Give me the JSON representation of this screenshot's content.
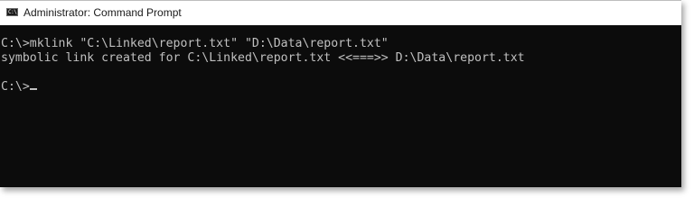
{
  "window": {
    "title": "Administrator: Command Prompt",
    "icon": "cmd-icon",
    "icon_glyph": "C:\\"
  },
  "console": {
    "lines": [
      "C:\\>mklink \"C:\\Linked\\report.txt\" \"D:\\Data\\report.txt\"",
      "symbolic link created for C:\\Linked\\report.txt <<===>> D:\\Data\\report.txt"
    ],
    "prompt": "C:\\>",
    "colors": {
      "background": "#0c0c0c",
      "foreground": "#c0c0c0"
    }
  }
}
